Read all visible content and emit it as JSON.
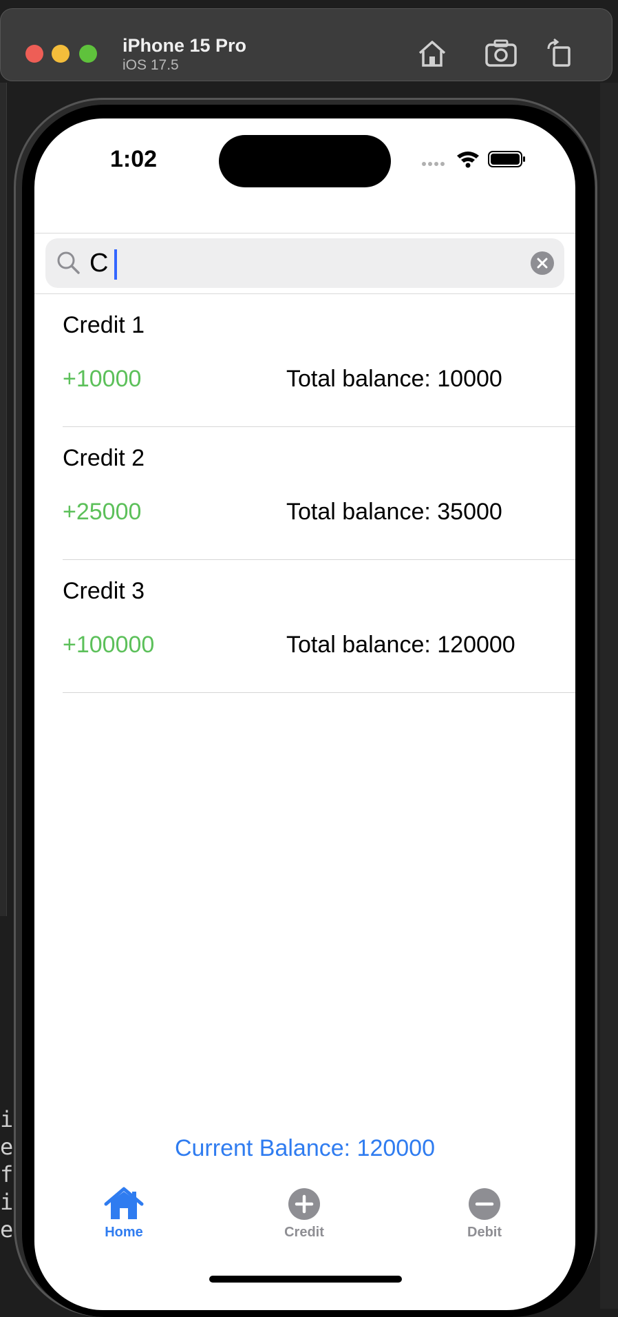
{
  "simulator": {
    "device_name": "iPhone 15 Pro",
    "os_version": "iOS 17.5",
    "buttons": [
      "home-icon",
      "screenshot-icon",
      "rotate-icon"
    ]
  },
  "background_code": [
    "ic",
    "es",
    "fo",
    "ior",
    "essic"
  ],
  "status_bar": {
    "time": "1:02",
    "icons": [
      "signal-icon",
      "wifi-icon",
      "battery-icon"
    ]
  },
  "search": {
    "value": "C",
    "placeholder": ""
  },
  "transactions": [
    {
      "title": "Credit 1",
      "amount": "+10000",
      "balance": "Total balance: 10000"
    },
    {
      "title": "Credit 2",
      "amount": "+25000",
      "balance": "Total balance: 35000"
    },
    {
      "title": "Credit 3",
      "amount": "+100000",
      "balance": "Total balance: 120000"
    }
  ],
  "current_balance": "Current Balance: 120000",
  "tabs": [
    {
      "label": "Home",
      "icon": "house-icon",
      "selected": true
    },
    {
      "label": "Credit",
      "icon": "plus-circle-icon",
      "selected": false
    },
    {
      "label": "Debit",
      "icon": "minus-circle-icon",
      "selected": false
    }
  ],
  "colors": {
    "accent": "#2f7cf0",
    "credit_amount": "#5cc05a",
    "inactive_tab": "#8e8e93"
  }
}
